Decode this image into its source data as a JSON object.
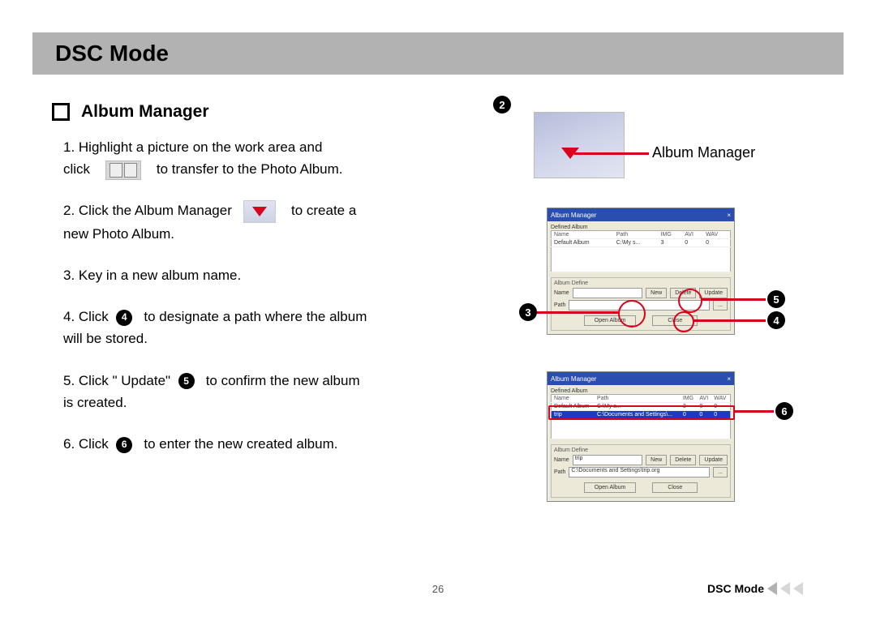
{
  "title": "DSC Mode",
  "section": "Album Manager",
  "steps": {
    "s1a": "1. Highlight a picture on the work area and",
    "s1b": "click",
    "s1c": "to transfer to the Photo Album.",
    "s2a": "2. Click the Album Manager",
    "s2b": "to create a",
    "s2c": "new Photo Album.",
    "s3": "3. Key in a new album name.",
    "s4a": "4. Click",
    "s4b": "to designate a path where the album",
    "s4c": "will be stored.",
    "s5a": "5. Click  \" Update\"",
    "s5b": "to confirm the new album",
    "s5c": "is created.",
    "s6a": "6. Click",
    "s6b": "to enter the new created album."
  },
  "callouts": {
    "n2": "2",
    "n3": "3",
    "n4": "4",
    "n5": "5",
    "n6": "6",
    "album_manager": "Album Manager"
  },
  "dialog1": {
    "title": "Album Manager",
    "group1_label": "Defined Album",
    "columns": [
      "Name",
      "Path",
      "IMG",
      "AVI",
      "WAV"
    ],
    "row0": [
      "Default Album",
      "C:\\My s...",
      "3",
      "0",
      "0"
    ],
    "group2_label": "Album Define",
    "field_name": "Name",
    "field_path": "Path",
    "btn_new": "New",
    "btn_delete": "Delete",
    "btn_update": "Update",
    "path_value": "",
    "btn_browse": "...",
    "btn_open": "Open Album",
    "btn_close": "Close"
  },
  "dialog2": {
    "title": "Album Manager",
    "group1_label": "Defined Album",
    "columns": [
      "Name",
      "Path",
      "IMG",
      "AVI",
      "WAV"
    ],
    "row0": [
      "Default Album",
      "C:\\My s...",
      "3",
      "0",
      "0"
    ],
    "row1": [
      "trip",
      "C:\\Documents and Settings\\...",
      "0",
      "0",
      "0"
    ],
    "group2_label": "Album Define",
    "field_name": "Name",
    "name_value": "trip",
    "field_path": "Path",
    "path_value": "C:\\Documents and Settings\\trip.org",
    "btn_new": "New",
    "btn_delete": "Delete",
    "btn_update": "Update",
    "btn_browse": "...",
    "btn_open": "Open Album",
    "btn_close": "Close"
  },
  "footer": {
    "page": "26",
    "mode": "DSC Mode"
  }
}
